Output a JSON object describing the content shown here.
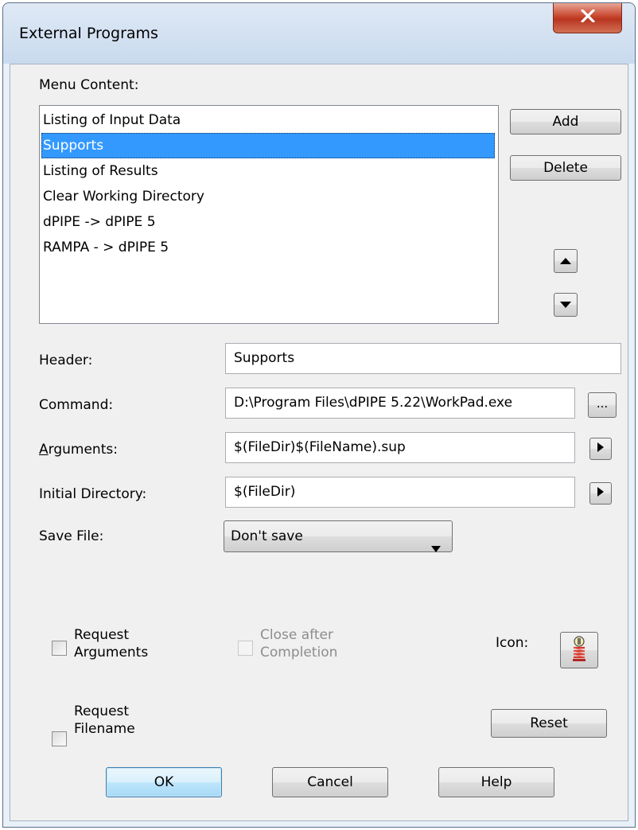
{
  "window": {
    "title": "External Programs",
    "close_glyph": "X"
  },
  "menu_content": {
    "label": "Menu Content:",
    "items": [
      {
        "label": "Listing of Input Data",
        "selected": false
      },
      {
        "label": "Supports",
        "selected": true
      },
      {
        "label": "Listing of Results",
        "selected": false
      },
      {
        "label": "Clear Working Directory",
        "selected": false
      },
      {
        "label": "dPIPE -> dPIPE 5",
        "selected": false
      },
      {
        "label": "RAMPA - > dPIPE 5",
        "selected": false
      }
    ]
  },
  "side_buttons": {
    "add": "Add",
    "delete": "Delete",
    "move_up_icon": "triangle-up-icon",
    "move_down_icon": "triangle-down-icon"
  },
  "form": {
    "header_label": "Header:",
    "header_value": "Supports",
    "command_label": "Command:",
    "command_value": "D:\\Program Files\\dPIPE 5.22\\WorkPad.exe",
    "browse_label": "...",
    "arguments_label_first": "A",
    "arguments_label_rest": "rguments:",
    "arguments_value": "$(FileDir)$(FileName).sup",
    "initial_dir_label": "Initial Directory:",
    "initial_dir_value": "$(FileDir)",
    "save_file_label": "Save File:",
    "save_file_value": "Don't save"
  },
  "options": {
    "request_arguments_line1": "Request",
    "request_arguments_line2": "Arguments",
    "close_after_line1": "Close after",
    "close_after_line2": "Completion",
    "request_filename_line1": "Request",
    "request_filename_line2": "Filename",
    "icon_label": "Icon:",
    "icon_name": "supports-spring-icon",
    "reset": "Reset"
  },
  "footer": {
    "ok": "OK",
    "cancel": "Cancel",
    "help": "Help"
  },
  "colors": {
    "selection": "#3399ff",
    "close_button": "#c7452d",
    "dialog_background": "#f0f0f0"
  }
}
